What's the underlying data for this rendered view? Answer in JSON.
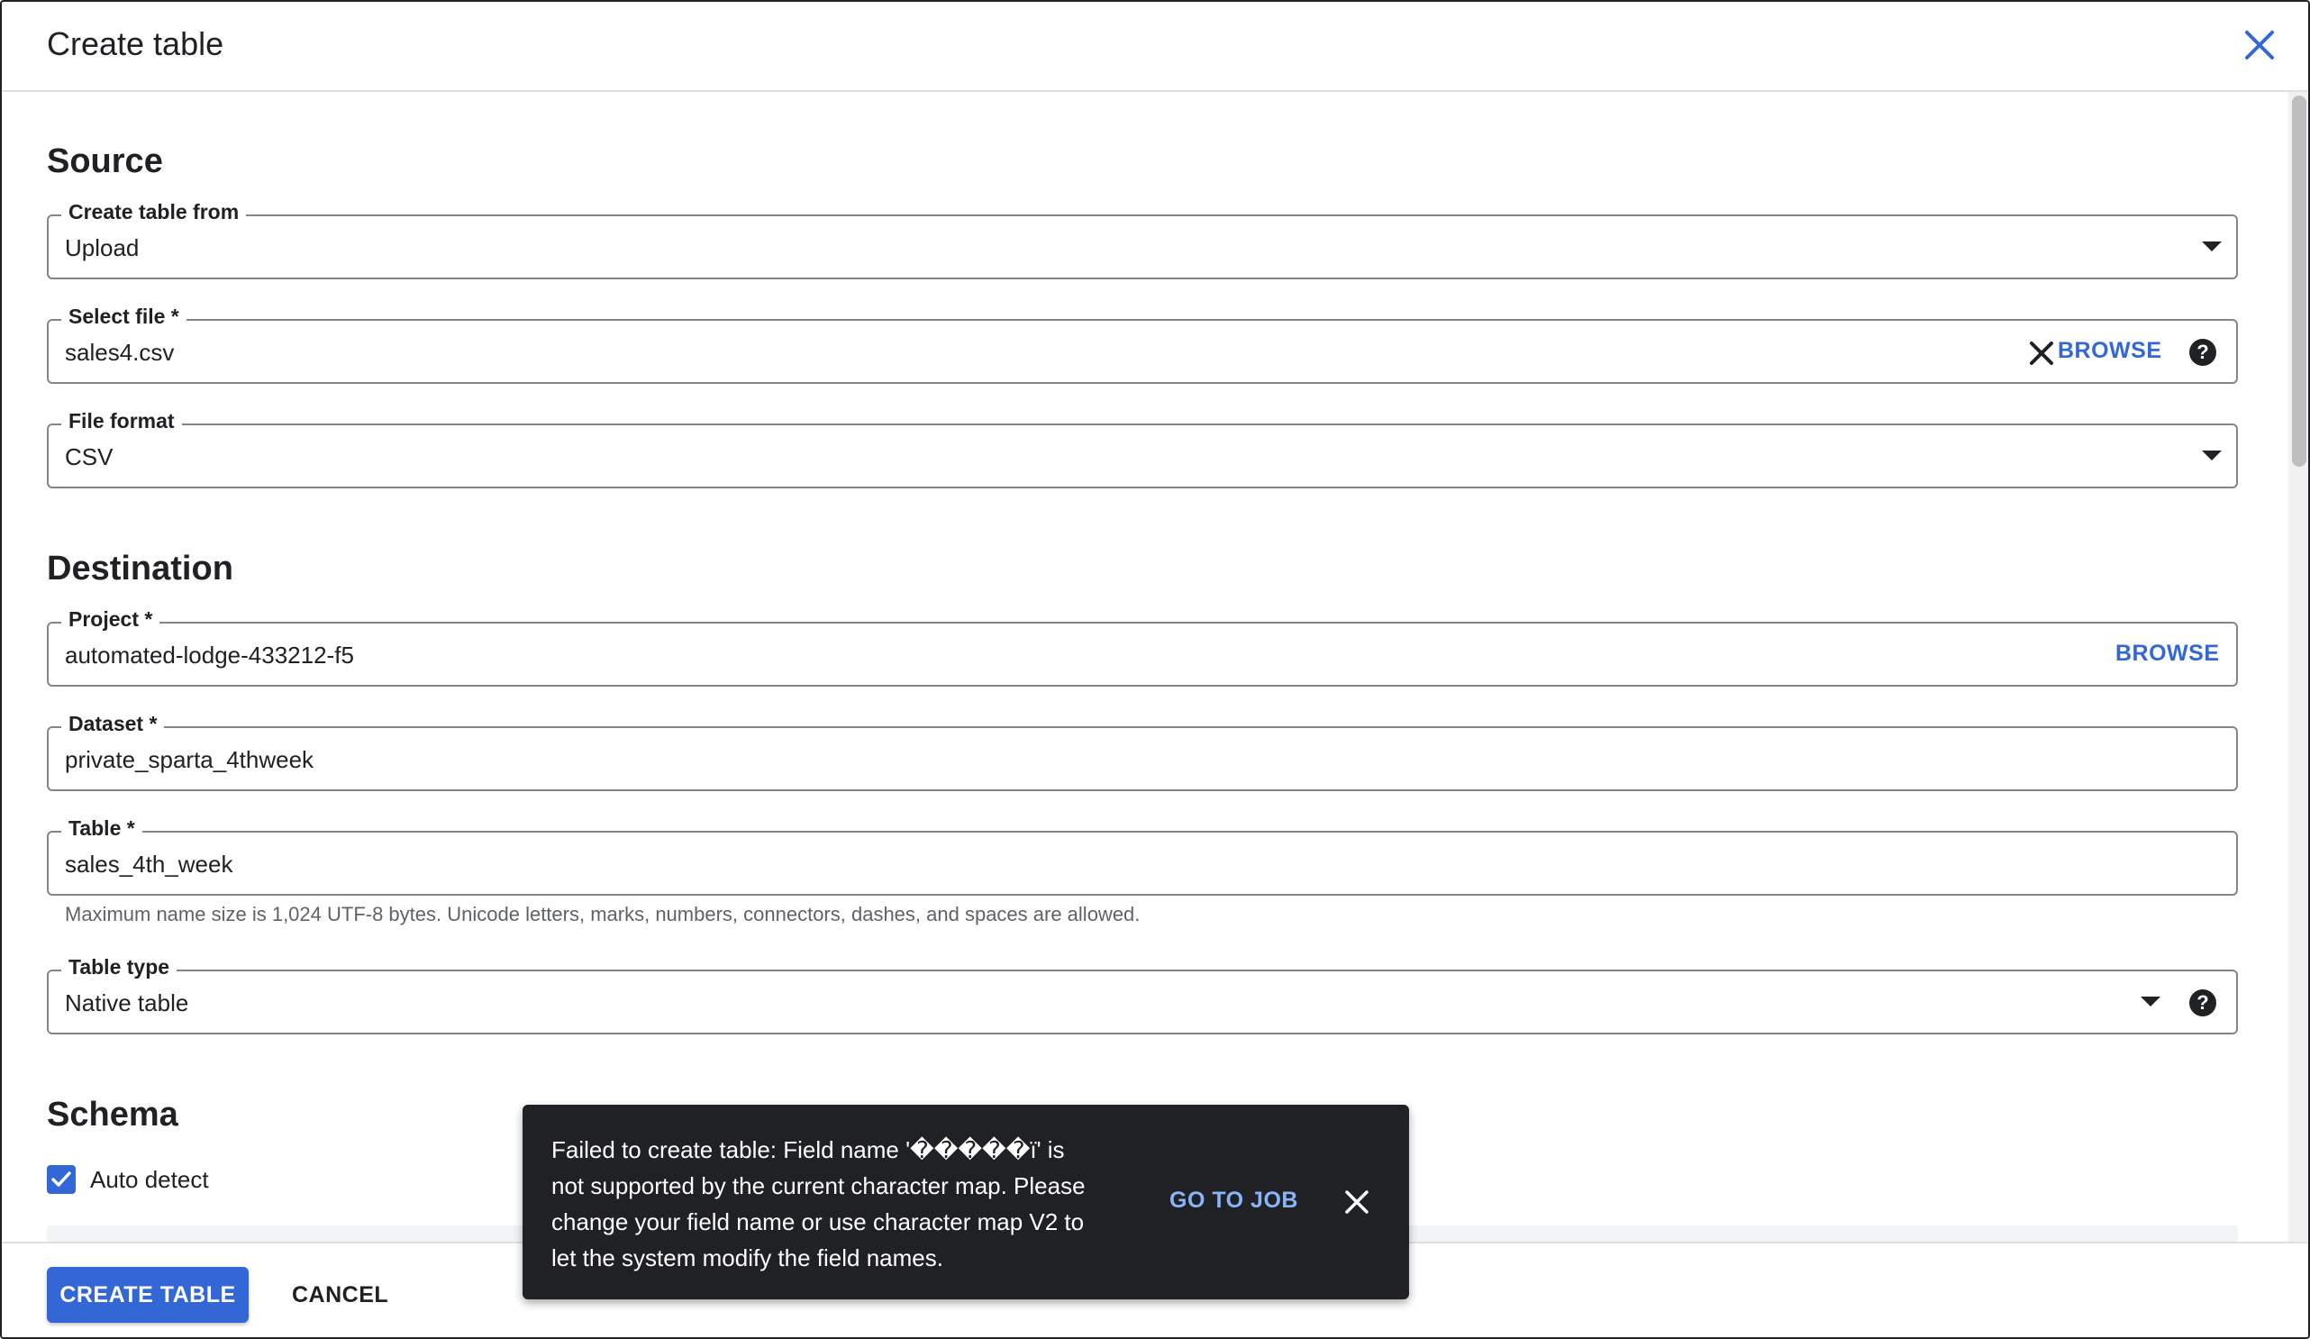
{
  "dialog": {
    "title": "Create table"
  },
  "source": {
    "heading": "Source",
    "create_from": {
      "label": "Create table from",
      "value": "Upload"
    },
    "select_file": {
      "label": "Select file *",
      "value": "sales4.csv",
      "browse": "BROWSE",
      "help": "?"
    },
    "file_format": {
      "label": "File format",
      "value": "CSV"
    }
  },
  "destination": {
    "heading": "Destination",
    "project": {
      "label": "Project *",
      "value": "automated-lodge-433212-f5",
      "browse": "BROWSE"
    },
    "dataset": {
      "label": "Dataset *",
      "value": "private_sparta_4thweek"
    },
    "table": {
      "label": "Table *",
      "value": "sales_4th_week",
      "hint": "Maximum name size is 1,024 UTF-8 bytes. Unicode letters, marks, numbers, connectors, dashes, and spaces are allowed."
    },
    "table_type": {
      "label": "Table type",
      "value": "Native table",
      "help": "?"
    }
  },
  "schema": {
    "heading": "Schema",
    "auto_detect": {
      "label": "Auto detect",
      "checked": true
    }
  },
  "footer": {
    "create_label": "CREATE TABLE",
    "cancel_label": "CANCEL"
  },
  "toast": {
    "message": "Failed to create table: Field name '�����ï' is not supported by the current character map. Please change your field name or use character map V2 to let the system modify the field names.",
    "action_label": "GO TO JOB"
  },
  "colors": {
    "accent": "#3367d6",
    "toast_bg": "#202124",
    "toast_action": "#8ab4f8",
    "border": "#80868b"
  }
}
